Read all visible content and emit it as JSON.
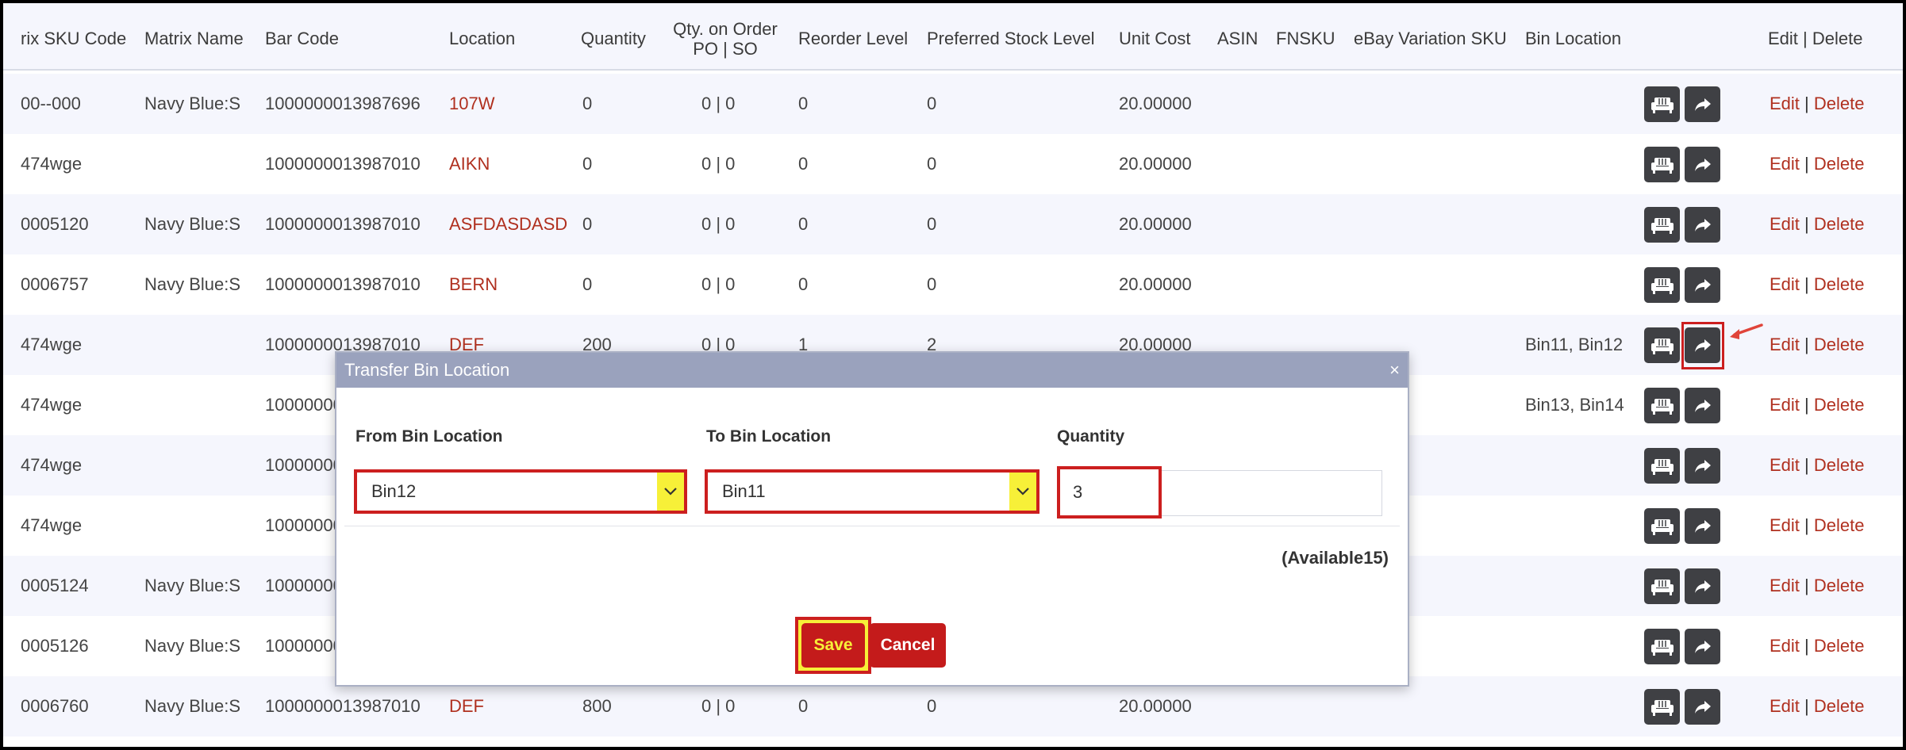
{
  "table": {
    "headers": {
      "matrix_sku": "rix SKU Code",
      "matrix_name": "Matrix Name",
      "bar_code": "Bar Code",
      "location": "Location",
      "quantity": "Quantity",
      "qty_on_order_line1": "Qty. on Order",
      "qty_on_order_line2": "PO | SO",
      "reorder": "Reorder Level",
      "preferred": "Preferred Stock Level",
      "unit_cost": "Unit Cost",
      "asin": "ASIN",
      "fnsku": "FNSKU",
      "ebay": "eBay Variation SKU",
      "bin_location": "Bin Location",
      "edit_delete": "Edit | Delete"
    },
    "rows": [
      {
        "sku": "00--000",
        "name": "Navy Blue:S",
        "bar": "1000000013987696",
        "loc": "107W",
        "qty": "0",
        "order": "0 | 0",
        "reorder": "0",
        "pref": "0",
        "cost": "20.00000",
        "bin": "",
        "edit": "Edit",
        "sep": "|",
        "del": "Delete"
      },
      {
        "sku": "474wge",
        "name": "",
        "bar": "1000000013987010",
        "loc": "AIKN",
        "qty": "0",
        "order": "0 | 0",
        "reorder": "0",
        "pref": "0",
        "cost": "20.00000",
        "bin": "",
        "edit": "Edit",
        "sep": "|",
        "del": "Delete"
      },
      {
        "sku": "0005120",
        "name": "Navy Blue:S",
        "bar": "1000000013987010",
        "loc": "ASFDASDASD",
        "qty": "0",
        "order": "0 | 0",
        "reorder": "0",
        "pref": "0",
        "cost": "20.00000",
        "bin": "",
        "edit": "Edit",
        "sep": "|",
        "del": "Delete"
      },
      {
        "sku": "0006757",
        "name": "Navy Blue:S",
        "bar": "1000000013987010",
        "loc": "BERN",
        "qty": "0",
        "order": "0 | 0",
        "reorder": "0",
        "pref": "0",
        "cost": "20.00000",
        "bin": "",
        "edit": "Edit",
        "sep": "|",
        "del": "Delete"
      },
      {
        "sku": "474wge",
        "name": "",
        "bar": "1000000013987010",
        "loc": "DEF",
        "qty": "200",
        "order": "0 | 0",
        "reorder": "1",
        "pref": "2",
        "cost": "20.00000",
        "bin": "Bin11, Bin12",
        "edit": "Edit",
        "sep": "|",
        "del": "Delete"
      },
      {
        "sku": "474wge",
        "name": "",
        "bar": "10000000",
        "loc": "",
        "qty": "",
        "order": "",
        "reorder": "",
        "pref": "",
        "cost": "",
        "bin": "Bin13, Bin14",
        "edit": "Edit",
        "sep": "|",
        "del": "Delete"
      },
      {
        "sku": "474wge",
        "name": "",
        "bar": "10000000",
        "loc": "",
        "qty": "",
        "order": "",
        "reorder": "",
        "pref": "",
        "cost": "",
        "bin": "",
        "edit": "Edit",
        "sep": "|",
        "del": "Delete"
      },
      {
        "sku": "474wge",
        "name": "",
        "bar": "10000000",
        "loc": "",
        "qty": "",
        "order": "",
        "reorder": "",
        "pref": "",
        "cost": "",
        "bin": "",
        "edit": "Edit",
        "sep": "|",
        "del": "Delete"
      },
      {
        "sku": "0005124",
        "name": "Navy Blue:S",
        "bar": "10000000",
        "loc": "",
        "qty": "",
        "order": "",
        "reorder": "",
        "pref": "",
        "cost": "",
        "bin": "",
        "edit": "Edit",
        "sep": "|",
        "del": "Delete"
      },
      {
        "sku": "0005126",
        "name": "Navy Blue:S",
        "bar": "10000000",
        "loc": "",
        "qty": "",
        "order": "",
        "reorder": "",
        "pref": "",
        "cost": "",
        "bin": "",
        "edit": "Edit",
        "sep": "|",
        "del": "Delete"
      },
      {
        "sku": "0006760",
        "name": "Navy Blue:S",
        "bar": "1000000013987010",
        "loc": "DEF",
        "qty": "800",
        "order": "0 | 0",
        "reorder": "0",
        "pref": "0",
        "cost": "20.00000",
        "bin": "",
        "edit": "Edit",
        "sep": "|",
        "del": "Delete"
      }
    ]
  },
  "modal": {
    "title": "Transfer Bin Location",
    "close": "×",
    "from_label": "From Bin Location",
    "to_label": "To Bin Location",
    "qty_label": "Quantity",
    "from_value": "Bin12",
    "to_value": "Bin11",
    "qty_value": "3",
    "available": "(Available15)",
    "save": "Save",
    "cancel": "Cancel"
  },
  "icons": {
    "bin_icon": "sofa-icon",
    "transfer_icon": "share-arrow-icon"
  },
  "colors": {
    "link_red": "#b0301f",
    "highlight_red": "#cc1f1f",
    "highlight_yellow": "#f7f038",
    "modal_header": "#9aa2bd",
    "icon_button": "#3f4044"
  }
}
